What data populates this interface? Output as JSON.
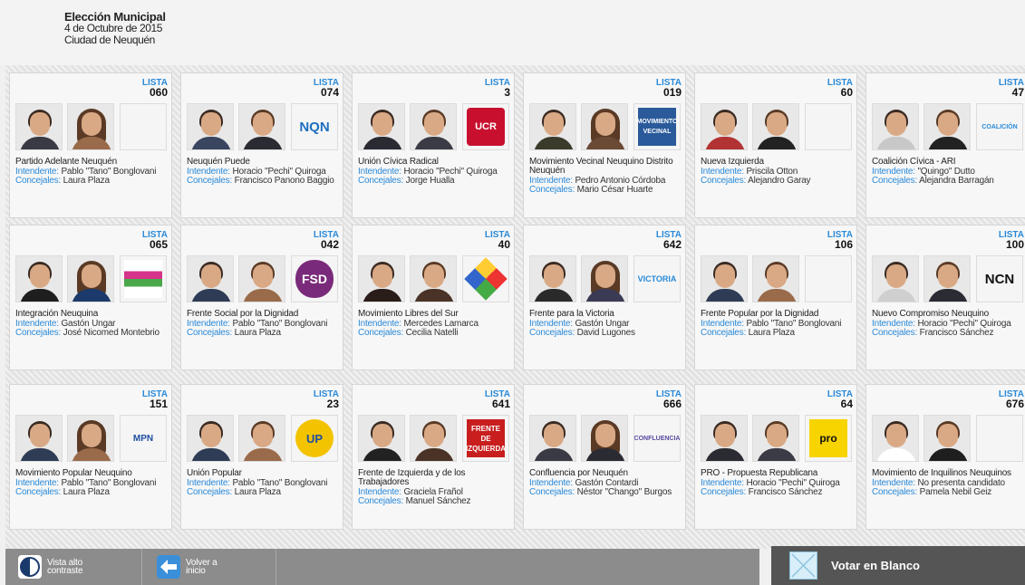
{
  "header": {
    "title": "Elección Municipal",
    "date": "4 de Octubre de 2015",
    "city": "Ciudad de Neuquén"
  },
  "labels": {
    "lista": "LISTA",
    "intendente": "Intendente:",
    "concejales": "Concejales:"
  },
  "cards": [
    {
      "lista": "060",
      "party": "Partido Adelante Neuquén",
      "intendente": "Pablo \"Tano\" Bonglovani",
      "concejales": "Laura Plaza",
      "logo": "",
      "c1": "#3a3a44",
      "c2": "#9a6b4a",
      "logo_icon": "empty"
    },
    {
      "lista": "074",
      "party": "Neuquén Puede",
      "intendente": "Horacio \"Pechi\" Quiroga",
      "concejales": "Francisco Panono Baggio",
      "logo": "NQN",
      "c1": "#3a4560",
      "c2": "#2b2b33",
      "logo_icon": "nqn-logo"
    },
    {
      "lista": "3",
      "party": "Unión Cívica Radical",
      "intendente": "Horacio \"Pechi\" Quiroga",
      "concejales": "Jorge Hualla",
      "logo": "UCR",
      "c1": "#2a2a33",
      "c2": "#3b3b45",
      "logo_icon": "ucr-logo"
    },
    {
      "lista": "019",
      "party": "Movimiento Vecinal Neuquino Distrito Neuquén",
      "intendente": "Pedro Antonio Córdoba",
      "concejales": "Mario César Huarte",
      "logo": "MOVIMIENTO VECINAL",
      "c1": "#3b3b2b",
      "c2": "#6a4a35",
      "logo_icon": "vecinal-logo"
    },
    {
      "lista": "60",
      "party": "Nueva Izquierda",
      "intendente": "Priscila Otton",
      "concejales": "Alejandro Garay",
      "logo": "",
      "c1": "#b23333",
      "c2": "#222",
      "logo_icon": "empty"
    },
    {
      "lista": "47",
      "party": "Coalición Cívica - ARI",
      "intendente": "\"Quingo\" Dutto",
      "concejales": "Alejandra Barragán",
      "logo": "COALICIÓN",
      "c1": "#c8c8c8",
      "c2": "#222",
      "logo_icon": "coalicion-logo"
    },
    {
      "lista": "065",
      "party": "Integración Neuquina",
      "intendente": "Gastón Ungar",
      "concejales": "José Nicomed Montebrio",
      "logo": "",
      "c1": "#1e1e1e",
      "c2": "#1c3a6b",
      "logo_icon": "integracion-logo"
    },
    {
      "lista": "042",
      "party": "Frente Social por la Dignidad",
      "intendente": "Pablo \"Tano\" Bonglovani",
      "concejales": "Laura Plaza",
      "logo": "FSD",
      "c1": "#2f3c55",
      "c2": "#9a6b4a",
      "logo_icon": "fsd-logo"
    },
    {
      "lista": "40",
      "party": "Movimiento Libres del Sur",
      "intendente": "Mercedes Lamarca",
      "concejales": "Cecilia Natelli",
      "logo": "",
      "c1": "#2a1c18",
      "c2": "#4a3326",
      "logo_icon": "libres-logo"
    },
    {
      "lista": "642",
      "party": "Frente para la Victoria",
      "intendente": "Gastón Ungar",
      "concejales": "David Lugones",
      "logo": "VICTORIA",
      "c1": "#2a2a2a",
      "c2": "#3a3a55",
      "logo_icon": "victoria-logo"
    },
    {
      "lista": "106",
      "party": "Frente Popular por la Dignidad",
      "intendente": "Pablo \"Tano\" Bonglovani",
      "concejales": "Laura Plaza",
      "logo": "",
      "c1": "#2f3c55",
      "c2": "#9a6b4a",
      "logo_icon": "empty"
    },
    {
      "lista": "100",
      "party": "Nuevo Compromiso Neuquino",
      "intendente": "Horacio \"Pechi\" Quiroga",
      "concejales": "Francisco Sánchez",
      "logo": "NCN",
      "c1": "#cfcfcf",
      "c2": "#2b2b33",
      "logo_icon": "ncn-logo"
    },
    {
      "lista": "151",
      "party": "Movimiento Popular Neuquino",
      "intendente": "Pablo \"Tano\" Bonglovani",
      "concejales": "Laura Plaza",
      "logo": "MPN",
      "c1": "#2f3c55",
      "c2": "#9a6b4a",
      "logo_icon": "mpn-logo"
    },
    {
      "lista": "23",
      "party": "Unión Popular",
      "intendente": "Pablo \"Tano\" Bonglovani",
      "concejales": "Laura Plaza",
      "logo": "UP",
      "c1": "#2f3c55",
      "c2": "#9a6b4a",
      "logo_icon": "up-logo"
    },
    {
      "lista": "641",
      "party": "Frente de Izquierda y de los Trabajadores",
      "intendente": "Graciela Frañol",
      "concejales": "Manuel Sánchez",
      "logo": "FRENTE DE IZQUIERDA",
      "c1": "#222",
      "c2": "#4a3326",
      "logo_icon": "fit-logo"
    },
    {
      "lista": "666",
      "party": "Confluencia por Neuquén",
      "intendente": "Gastón Contardi",
      "concejales": "Néstor \"Chango\" Burgos",
      "logo": "CONFLUENCIA",
      "c1": "#3a3a44",
      "c2": "#2b2b33",
      "logo_icon": "confluencia-logo"
    },
    {
      "lista": "64",
      "party": "PRO - Propuesta Republicana",
      "intendente": "Horacio \"Pechi\" Quiroga",
      "concejales": "Francisco Sánchez",
      "logo": "pro",
      "c1": "#2b2b33",
      "c2": "#3b3b45",
      "logo_icon": "pro-logo"
    },
    {
      "lista": "676",
      "party": "Movimiento de Inquilinos Neuquinos",
      "intendente": "No presenta candidato",
      "concejales": "Pamela Nebil Geiz",
      "logo": "",
      "c1": "#ffffff",
      "c2": "#1e1e1e",
      "logo_icon": "inquilinos-logo"
    }
  ],
  "footer": {
    "contrast_label": "Vista alto contraste",
    "back_label": "Volver a inicio",
    "blank_vote_label": "Votar en Blanco"
  },
  "colors": {
    "accent_blue": "#2a8ad8",
    "footer_gray": "#8c8c8c",
    "blank_button": "#555555"
  }
}
